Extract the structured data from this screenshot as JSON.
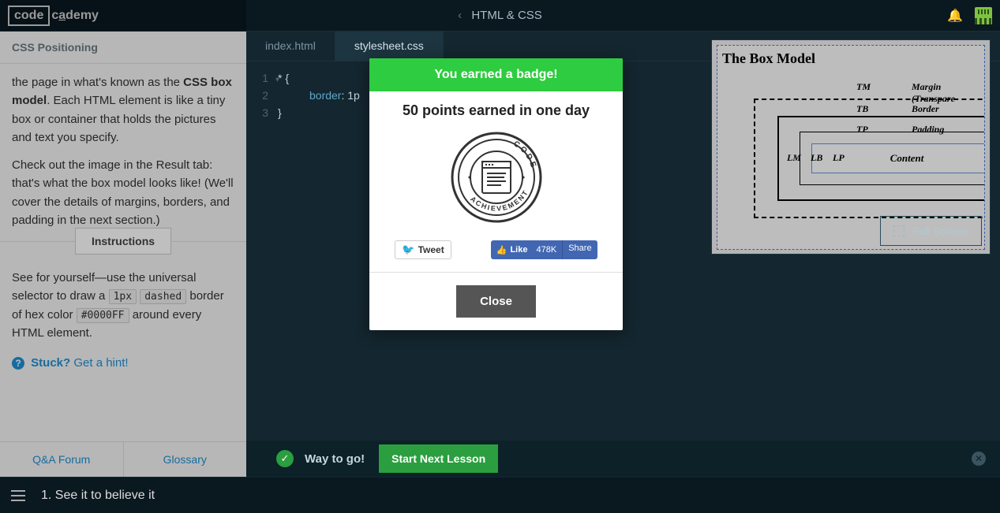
{
  "topbar": {
    "logo_box": "code",
    "logo_rest_c": "c",
    "logo_rest_a": "a",
    "logo_rest_demy": "demy",
    "course_title": "HTML & CSS"
  },
  "sidebar": {
    "section": "CSS Positioning",
    "para_frag1": "the page in what's known as the ",
    "para_bold": "CSS box model",
    "para_frag2": ". Each HTML element is like a tiny box or container that holds the pictures and text you specify.",
    "para2": "Check out the image in the Result tab: that's what the box model looks like! (We'll cover the details of margins, borders, and padding in the next section.)",
    "instructions_label": "Instructions",
    "instr_1": "See for yourself—use the universal selector to draw a ",
    "chip1": "1px",
    "chip2": "dashed",
    "instr_2": " border of hex color ",
    "chip3": "#0000FF",
    "instr_3": " around every HTML element.",
    "stuck": "Stuck?",
    "hint": "Get a hint!",
    "qa": "Q&A Forum",
    "glossary": "Glossary"
  },
  "tabs": {
    "t1": "index.html",
    "t2": "stylesheet.css"
  },
  "code": {
    "l1a": "* ",
    "l1b": "{",
    "l2a": "border",
    "l2b": ": ",
    "l2c": "1p",
    "l3": "}",
    "n1": "1",
    "n2": "2",
    "n3": "3"
  },
  "result": {
    "title": "The Box Model",
    "content": "Content",
    "tm": "TM",
    "tb": "TB",
    "tp": "TP",
    "lm": "LM",
    "lb": "LB",
    "lp": "LP",
    "margin": "Margin (Transpare",
    "border": "Border",
    "padding": "Padding",
    "fullscreen": "Full Screen"
  },
  "bottom": {
    "way": "Way to go!",
    "next": "Start Next Lesson"
  },
  "footer": {
    "title": "1. See it to believe it"
  },
  "modal": {
    "head": "You earned a badge!",
    "sub": "50 points earned in one day",
    "tweet": "Tweet",
    "like": "Like",
    "like_count": "478K",
    "share": "Share",
    "close": "Close",
    "badge_top": "CODE",
    "badge_bottom": "ACHIEVEMENT"
  }
}
